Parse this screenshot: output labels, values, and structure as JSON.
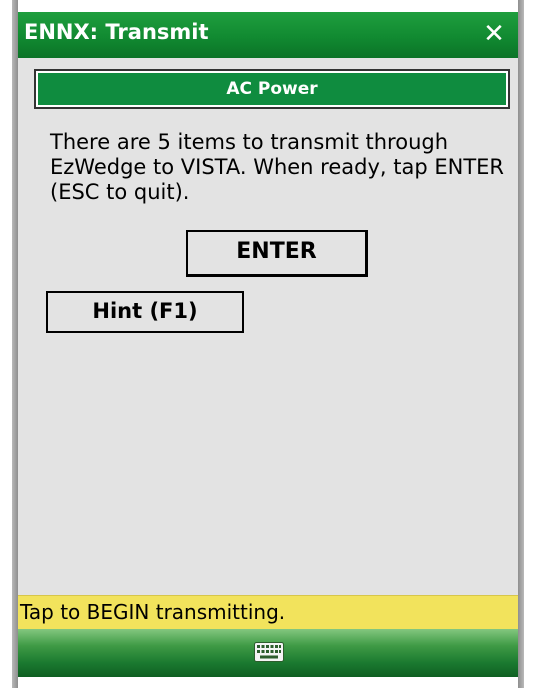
{
  "window": {
    "title": "ENNX: Transmit",
    "close_label": "✕"
  },
  "banner": {
    "text": "AC Power"
  },
  "main": {
    "message": "There are 5 items to transmit through EzWedge to VISTA.  When ready, tap ENTER (ESC to quit).",
    "enter_label": "ENTER",
    "hint_label": "Hint (F1)"
  },
  "status": {
    "text": "Tap to BEGIN transmitting."
  },
  "taskbar": {
    "keyboard_icon": "keyboard-icon"
  },
  "colors": {
    "title_bar": "#118a31",
    "banner": "#0f8c3f",
    "background": "#e3e3e3",
    "status_bar": "#f2e35c"
  }
}
